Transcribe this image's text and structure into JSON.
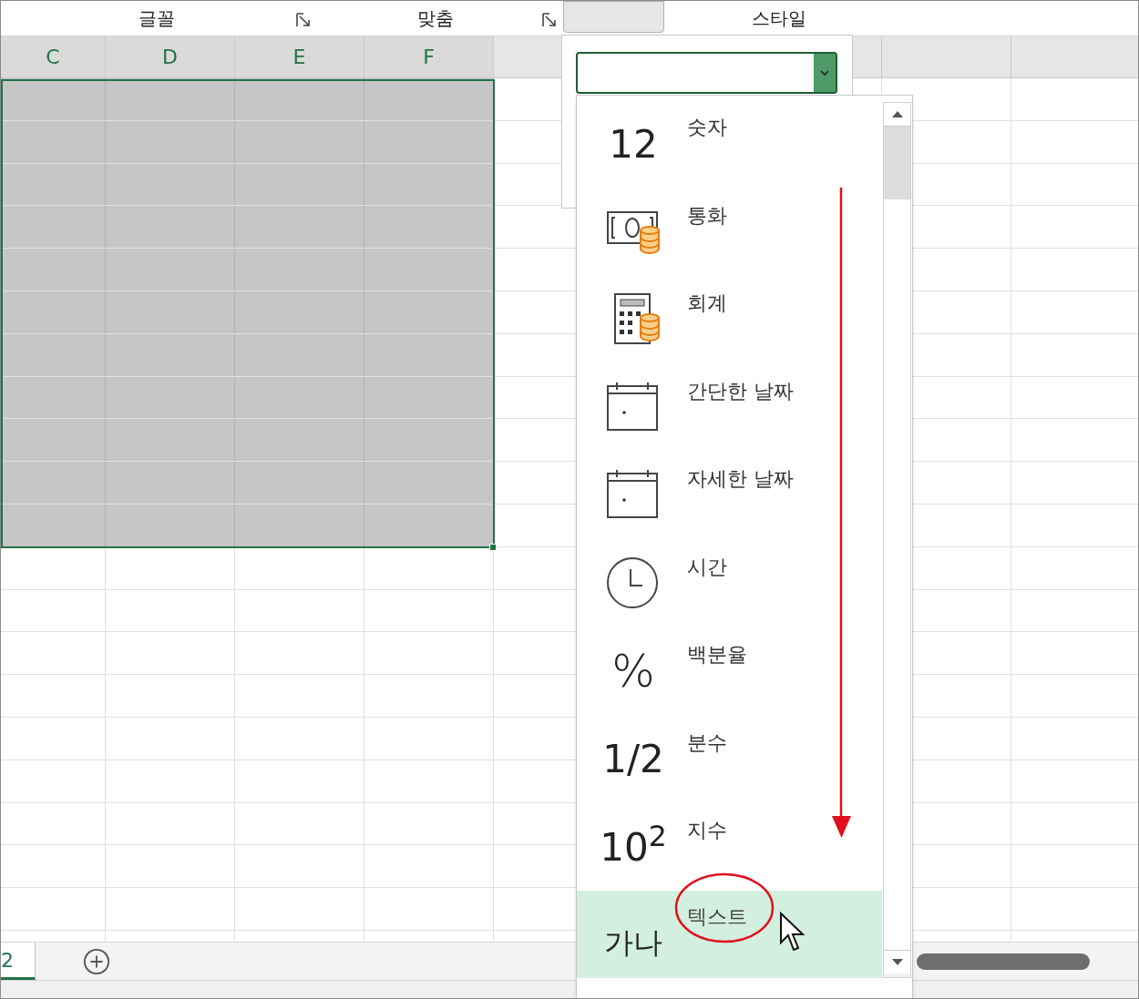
{
  "ribbon_groups": [
    {
      "label": "글꼴",
      "launcher": true
    },
    {
      "label": "맞춤",
      "launcher": true
    },
    {
      "label": "스타일",
      "launcher": false
    }
  ],
  "column_headers": [
    {
      "label": "C",
      "selected": true
    },
    {
      "label": "D",
      "selected": true
    },
    {
      "label": "E",
      "selected": true
    },
    {
      "label": "F",
      "selected": true
    }
  ],
  "sheet_tabs": [
    {
      "label": "2",
      "selected": true
    }
  ],
  "format_list": [
    {
      "kind": "number",
      "icon_text": "12",
      "label": "숫자",
      "selected": false
    },
    {
      "kind": "currency",
      "label": "통화",
      "selected": false
    },
    {
      "kind": "accounting",
      "label": "회계",
      "selected": false
    },
    {
      "kind": "short-date",
      "label": "간단한 날짜",
      "selected": false
    },
    {
      "kind": "long-date",
      "label": "자세한 날짜",
      "selected": false
    },
    {
      "kind": "time",
      "label": "시간",
      "selected": false
    },
    {
      "kind": "percent",
      "icon_text": "%",
      "label": "백분율",
      "selected": false
    },
    {
      "kind": "fraction",
      "icon_text": "1/2",
      "label": "분수",
      "selected": false
    },
    {
      "kind": "scientific",
      "icon_text": "10$^{2}$",
      "label": "지수",
      "selected": false
    },
    {
      "kind": "text",
      "icon_text": "가나",
      "label": "텍스트",
      "selected": true
    }
  ]
}
